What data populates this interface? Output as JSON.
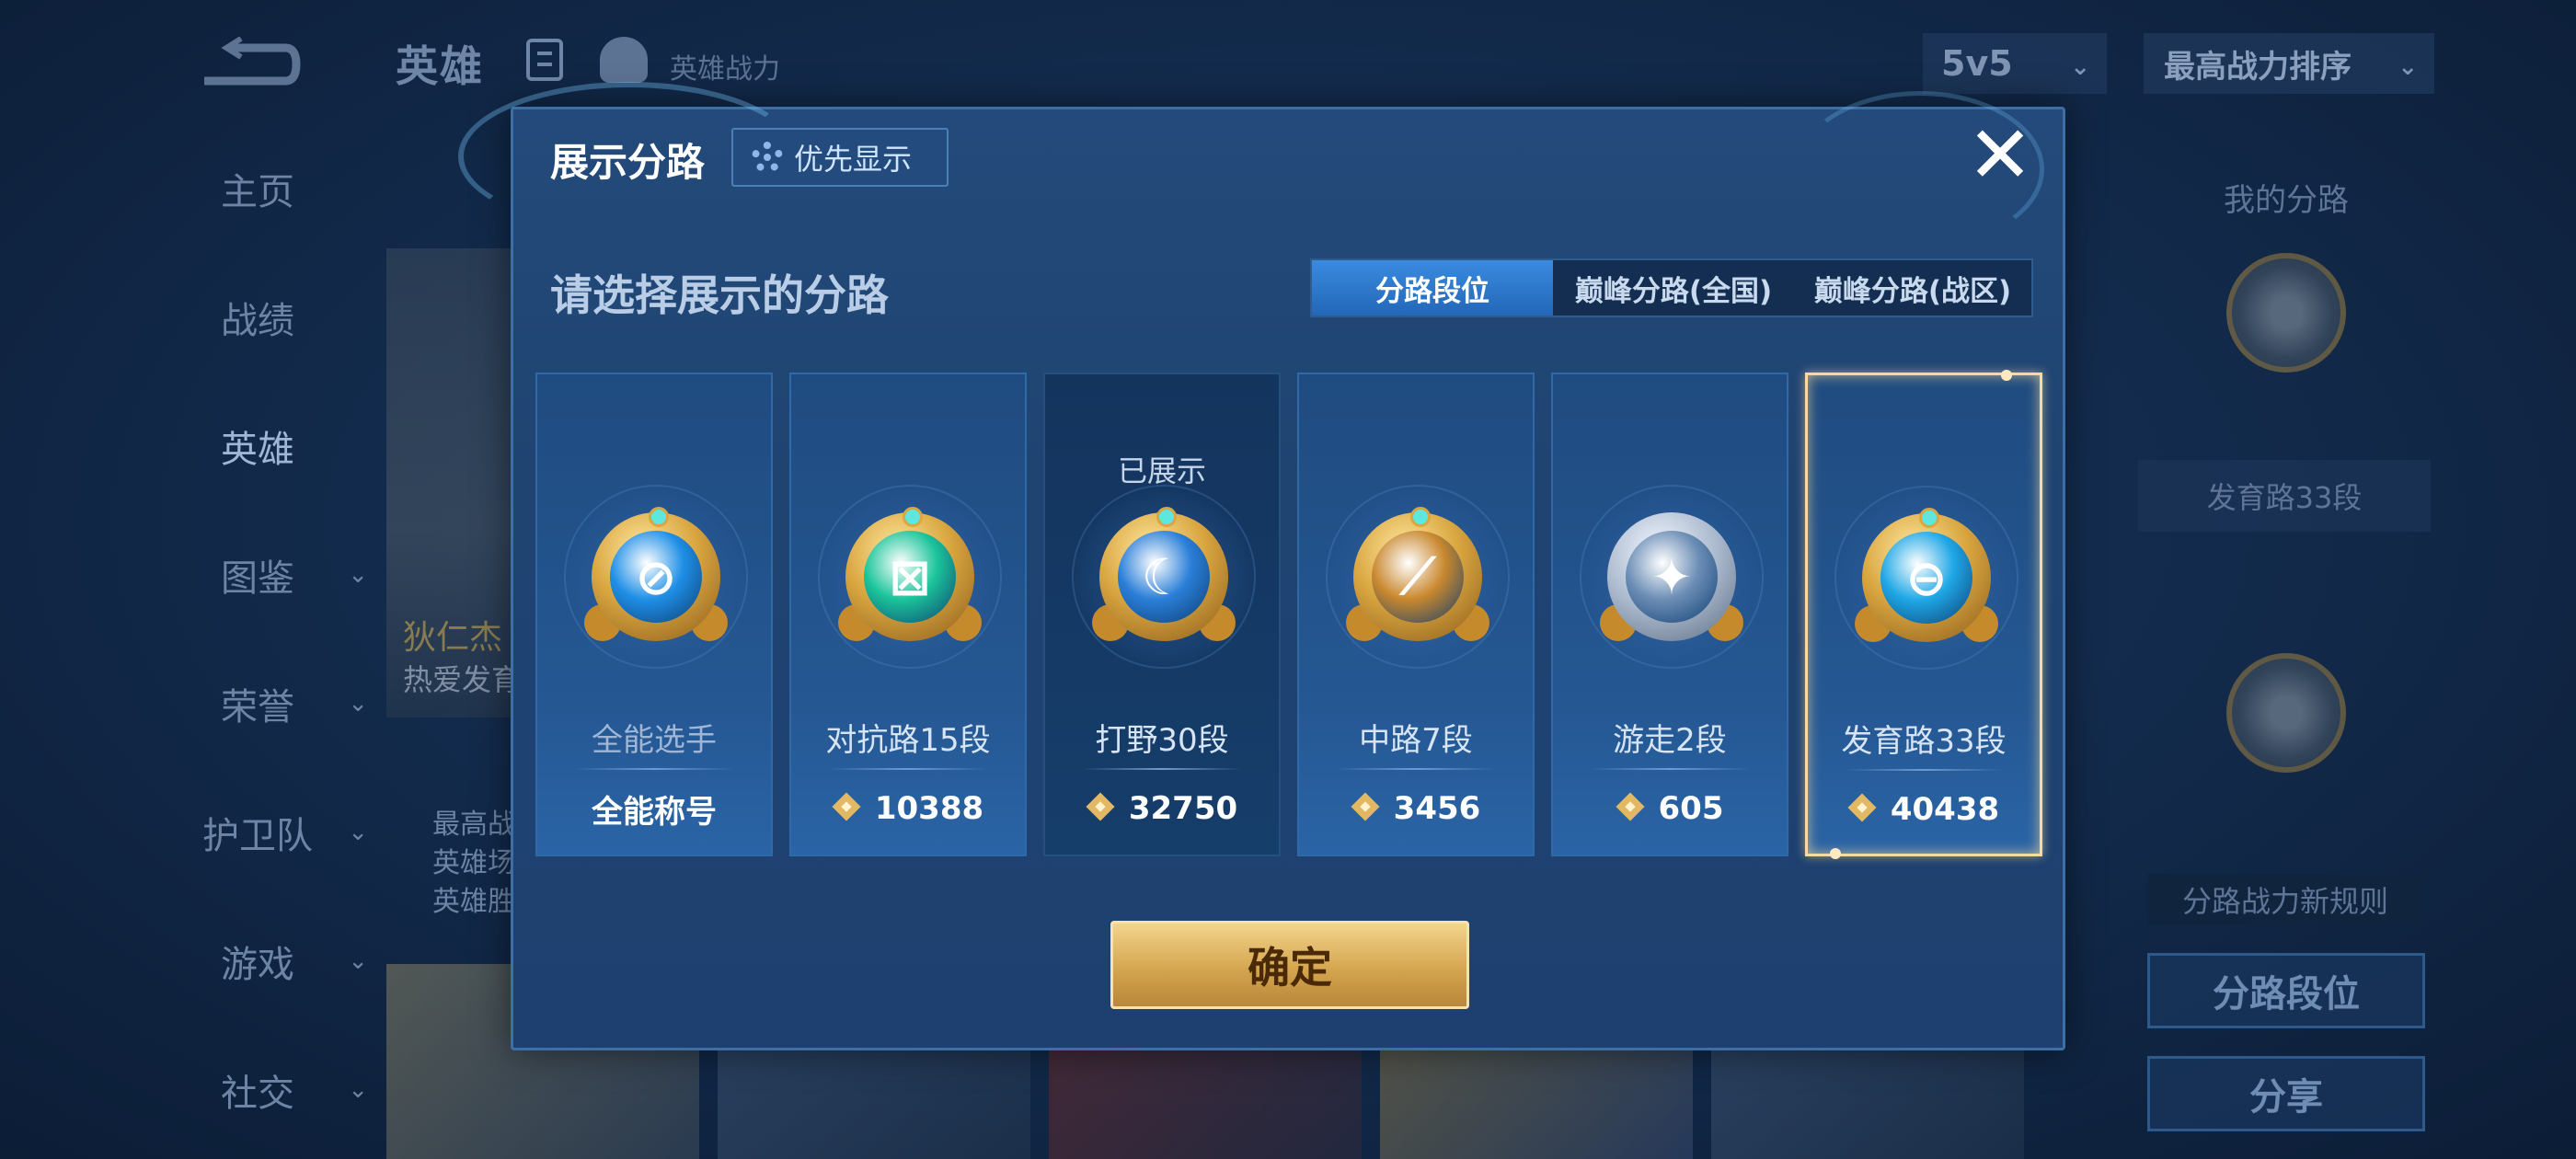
{
  "background": {
    "top_title": "英雄",
    "top_power": "英雄战力",
    "mode_select": "5v5",
    "sort_select": "最高战力排序",
    "nav_items": [
      {
        "label": "主页",
        "has_chevron": false
      },
      {
        "label": "战绩",
        "has_chevron": false
      },
      {
        "label": "英雄",
        "has_chevron": false,
        "active": true
      },
      {
        "label": "图鉴",
        "has_chevron": true
      },
      {
        "label": "荣誉",
        "has_chevron": true
      },
      {
        "label": "护卫队",
        "has_chevron": true
      },
      {
        "label": "游戏",
        "has_chevron": true
      },
      {
        "label": "社交",
        "has_chevron": true
      }
    ],
    "hero_name": "狄仁杰",
    "hero_tag": "热爱发育",
    "hero_stats": [
      "最高战",
      "英雄场",
      "英雄胜"
    ],
    "right_panel": {
      "title": "我的分路",
      "lane_label": "发育路33段",
      "rule_text": "分路战力新规则",
      "button_lane_rank": "分路段位",
      "button_share": "分享"
    }
  },
  "modal": {
    "title": "展示分路",
    "priority_button": "优先显示",
    "subtitle": "请选择展示的分路",
    "tabs": [
      {
        "label": "分路段位",
        "active": true
      },
      {
        "label": "巅峰分路(全国)",
        "active": false
      },
      {
        "label": "巅峰分路(战区)",
        "active": false
      }
    ],
    "shown_tag": "已展示",
    "cards": [
      {
        "lane": "全能选手",
        "value": "全能称号",
        "has_power_icon": false,
        "glyph": "⊘",
        "core_color": "#1f8fe6",
        "badge_style": "gold",
        "shown": false,
        "selected": false
      },
      {
        "lane": "对抗路15段",
        "value": "10388",
        "has_power_icon": true,
        "glyph": "⊠",
        "core_color": "#1bc49a",
        "badge_style": "gold",
        "shown": false,
        "selected": false
      },
      {
        "lane": "打野30段",
        "value": "32750",
        "has_power_icon": true,
        "glyph": "☾",
        "core_color": "#2a7fd8",
        "badge_style": "gold",
        "shown": true,
        "selected": false
      },
      {
        "lane": "中路7段",
        "value": "3456",
        "has_power_icon": true,
        "glyph": "⟋",
        "core_color": "#c9882e",
        "badge_style": "gold",
        "shown": false,
        "selected": false
      },
      {
        "lane": "游走2段",
        "value": "605",
        "has_power_icon": true,
        "glyph": "✦",
        "core_color": "#6c8eb6",
        "badge_style": "silver",
        "shown": false,
        "selected": false
      },
      {
        "lane": "发育路33段",
        "value": "40438",
        "has_power_icon": true,
        "glyph": "⊖",
        "core_color": "#1fa7e6",
        "badge_style": "gold",
        "shown": false,
        "selected": true
      }
    ],
    "confirm_button": "确定"
  },
  "colors": {
    "modal_bg": "#1f4472",
    "tab_active": "#2f7bd0",
    "confirm_gold": "#d5a650",
    "selected_border": "#f7d9a2"
  }
}
